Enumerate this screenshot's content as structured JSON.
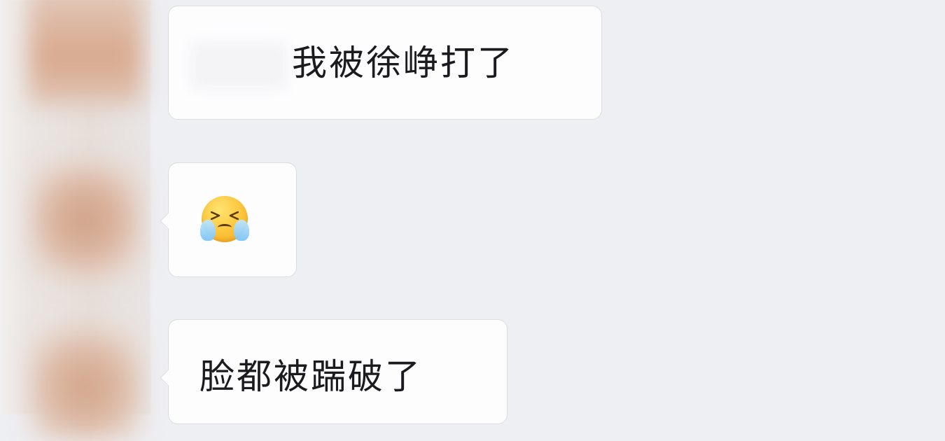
{
  "chat": {
    "messages": [
      {
        "type": "text",
        "text": "我被徐峥打了"
      },
      {
        "type": "emoji",
        "emoji": "crying-face-icon"
      },
      {
        "type": "text",
        "text": "脸都被踹破了"
      }
    ]
  },
  "colors": {
    "background": "#eeeff3",
    "bubble": "#fdfdfe",
    "bubble_border": "#dcdde2",
    "text": "#1b1b1f"
  }
}
